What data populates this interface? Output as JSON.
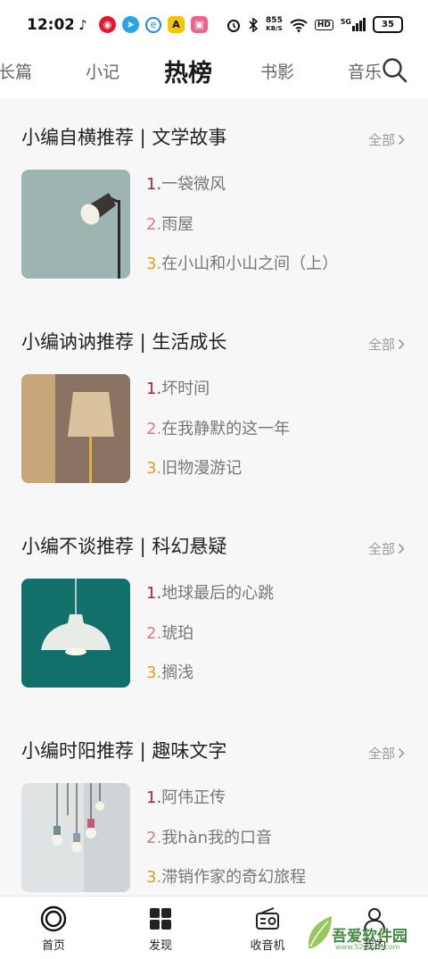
{
  "status_bar": {
    "time": "12:02",
    "net_speed_value": "855",
    "net_speed_unit": "KB/S",
    "hd_badge": "HD",
    "signal_label": "5G",
    "battery": "35"
  },
  "tabs": {
    "items": [
      "长篇",
      "小记",
      "热榜",
      "书影",
      "音乐"
    ],
    "active": "热榜"
  },
  "sections": [
    {
      "title": "小编自横推荐 | 文学故事",
      "all_label": "全部",
      "books": [
        {
          "num": "1.",
          "title": "一袋微风"
        },
        {
          "num": "2.",
          "title": "雨屋"
        },
        {
          "num": "3.",
          "title": "在小山和小山之间（上）"
        }
      ]
    },
    {
      "title": "小编讷讷推荐 | 生活成长",
      "all_label": "全部",
      "books": [
        {
          "num": "1.",
          "title": "坏时间"
        },
        {
          "num": "2.",
          "title": "在我静默的这一年"
        },
        {
          "num": "3.",
          "title": "旧物漫游记"
        }
      ]
    },
    {
      "title": "小编不谈推荐 | 科幻悬疑",
      "all_label": "全部",
      "books": [
        {
          "num": "1.",
          "title": "地球最后的心跳"
        },
        {
          "num": "2.",
          "title": "琥珀"
        },
        {
          "num": "3.",
          "title": "搁浅"
        }
      ]
    },
    {
      "title": "小编时阳推荐 | 趣味文字",
      "all_label": "全部",
      "books": [
        {
          "num": "1.",
          "title": "阿伟正传"
        },
        {
          "num": "2.",
          "title": "我hàn我的口音"
        },
        {
          "num": "3.",
          "title": "滞销作家的奇幻旅程"
        }
      ]
    }
  ],
  "rank_colors": [
    "#b0223a",
    "#e07a7a",
    "#e0a020"
  ],
  "bottom_nav": {
    "items": [
      {
        "label": "首页",
        "icon": "home-circle-icon"
      },
      {
        "label": "发现",
        "icon": "discover-grid-icon"
      },
      {
        "label": "收音机",
        "icon": "radio-icon"
      },
      {
        "label": "我的",
        "icon": "profile-icon"
      }
    ]
  },
  "watermark": {
    "text": "吾爱软件园",
    "sub": "www.52zixue.com"
  }
}
